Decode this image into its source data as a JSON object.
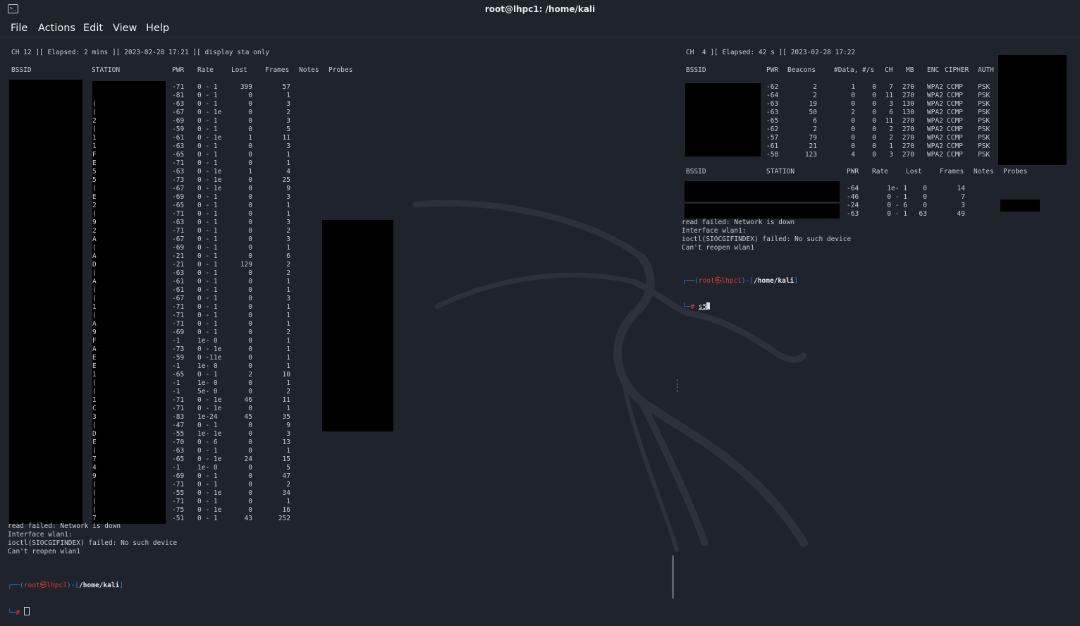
{
  "window": {
    "title": "root@lhpc1: /home/kali"
  },
  "menu": [
    "File",
    "Actions",
    "Edit",
    "View",
    "Help"
  ],
  "left": {
    "header": "CH 12 ][ Elapsed: 2 mins ][ 2023-02-28 17:21 ][ display sta only",
    "columns": [
      "BSSID",
      "STATION",
      "PWR",
      "Rate",
      "Lost",
      "Frames",
      "Notes",
      "Probes"
    ],
    "rows": [
      [
        "-71",
        "0 - 1",
        "399",
        "57"
      ],
      [
        "-81",
        "0 - 1",
        "0",
        "1"
      ],
      [
        "-63",
        "0 - 1",
        "0",
        "3"
      ],
      [
        "-67",
        "0 - 1e",
        "0",
        "2"
      ],
      [
        "-69",
        "0 - 1",
        "0",
        "3"
      ],
      [
        "-59",
        "0 - 1",
        "0",
        "5"
      ],
      [
        "-61",
        "0 - 1e",
        "1",
        "11"
      ],
      [
        "-63",
        "0 - 1",
        "0",
        "3"
      ],
      [
        "-65",
        "0 - 1",
        "0",
        "1"
      ],
      [
        "-71",
        "0 - 1",
        "0",
        "1"
      ],
      [
        "-63",
        "0 - 1e",
        "1",
        "4"
      ],
      [
        "-73",
        "0 - 1e",
        "0",
        "25"
      ],
      [
        "-67",
        "0 - 1e",
        "0",
        "9"
      ],
      [
        "-69",
        "0 - 1",
        "0",
        "3"
      ],
      [
        "-65",
        "0 - 1",
        "0",
        "1"
      ],
      [
        "-71",
        "0 - 1",
        "0",
        "1"
      ],
      [
        "-63",
        "0 - 1",
        "0",
        "3"
      ],
      [
        "-71",
        "0 - 1",
        "0",
        "2"
      ],
      [
        "-67",
        "0 - 1",
        "0",
        "3"
      ],
      [
        "-69",
        "0 - 1",
        "0",
        "1"
      ],
      [
        "-21",
        "0 - 1",
        "0",
        "6"
      ],
      [
        "-21",
        "0 - 1",
        "129",
        "2"
      ],
      [
        "-63",
        "0 - 1",
        "0",
        "2"
      ],
      [
        "-61",
        "0 - 1",
        "0",
        "1"
      ],
      [
        "-61",
        "0 - 1",
        "0",
        "1"
      ],
      [
        "-67",
        "0 - 1",
        "0",
        "3"
      ],
      [
        "-71",
        "0 - 1",
        "0",
        "1"
      ],
      [
        "-71",
        "0 - 1",
        "0",
        "1"
      ],
      [
        "-71",
        "0 - 1",
        "0",
        "1"
      ],
      [
        "-69",
        "0 - 1",
        "0",
        "2"
      ],
      [
        "-1",
        "1e- 0",
        "0",
        "1"
      ],
      [
        "-73",
        "0 - 1e",
        "0",
        "1"
      ],
      [
        "-59",
        "0 -11e",
        "0",
        "1"
      ],
      [
        "-1",
        "1e- 0",
        "0",
        "1"
      ],
      [
        "-65",
        "0 - 1",
        "2",
        "10"
      ],
      [
        "-1",
        "1e- 0",
        "0",
        "1"
      ],
      [
        "-1",
        "5e- 0",
        "0",
        "2"
      ],
      [
        "-71",
        "0 - 1e",
        "46",
        "11"
      ],
      [
        "-71",
        "0 - 1e",
        "0",
        "1"
      ],
      [
        "-83",
        "1e-24",
        "45",
        "35"
      ],
      [
        "-47",
        "0 - 1",
        "0",
        "9"
      ],
      [
        "-55",
        "1e- 1e",
        "0",
        "3"
      ],
      [
        "-70",
        "0 - 6",
        "0",
        "13"
      ],
      [
        "-63",
        "0 - 1",
        "0",
        "1"
      ],
      [
        "-65",
        "0 - 1e",
        "24",
        "15"
      ],
      [
        "-1",
        "1e- 0",
        "0",
        "5"
      ],
      [
        "-69",
        "0 - 1",
        "0",
        "47"
      ],
      [
        "-71",
        "0 - 1",
        "0",
        "2"
      ],
      [
        "-55",
        "0 - 1e",
        "0",
        "34"
      ],
      [
        "-71",
        "0 - 1",
        "0",
        "1"
      ],
      [
        "-75",
        "0 - 1e",
        "0",
        "16"
      ],
      [
        "-51",
        "0 - 1",
        "43",
        "252"
      ]
    ],
    "station_prefixes": [
      "",
      "",
      "(",
      "(",
      "2",
      "(",
      "1",
      "1",
      "F",
      "E",
      "5",
      "5",
      "(",
      "E",
      "2",
      "(",
      "9",
      "2",
      "A",
      "(",
      "A",
      "D",
      "(",
      "A",
      "(",
      "(",
      "1",
      "(",
      "A",
      "9",
      "F",
      "A",
      "E",
      "E",
      "1",
      "(",
      "(",
      "1",
      "C",
      "3",
      "(",
      "D",
      "E",
      "(",
      "7",
      "4",
      "9",
      "(",
      "(",
      "(",
      "(",
      "7"
    ],
    "messages": [
      "read failed: Network is down",
      "Interface wlan1:",
      "ioctl(SIOCGIFINDEX) failed: No such device",
      "Can't reopen wlan1"
    ],
    "prompt_user": "root",
    "prompt_host": "lhpc1",
    "prompt_path": "/home/kali"
  },
  "right": {
    "header": "CH  4 ][ Elapsed: 42 s ][ 2023-02-28 17:22",
    "ap_columns": [
      "BSSID",
      "PWR",
      "Beacons",
      "#Data, #/s",
      "CH",
      "MB",
      "ENC",
      "CIPHER",
      "AUTH"
    ],
    "ap_rows": [
      [
        "-62",
        "2",
        "1",
        "0",
        "7",
        "270",
        "WPA2",
        "CCMP",
        "PSK"
      ],
      [
        "-64",
        "2",
        "0",
        "0",
        "11",
        "270",
        "WPA2",
        "CCMP",
        "PSK"
      ],
      [
        "-63",
        "19",
        "0",
        "0",
        "3",
        "130",
        "WPA2",
        "CCMP",
        "PSK"
      ],
      [
        "-63",
        "50",
        "2",
        "0",
        "6",
        "130",
        "WPA2",
        "CCMP",
        "PSK"
      ],
      [
        "-65",
        "6",
        "0",
        "0",
        "11",
        "270",
        "WPA2",
        "CCMP",
        "PSK"
      ],
      [
        "-62",
        "2",
        "0",
        "0",
        "2",
        "270",
        "WPA2",
        "CCMP",
        "PSK"
      ],
      [
        "-57",
        "79",
        "0",
        "0",
        "2",
        "270",
        "WPA2",
        "CCMP",
        "PSK"
      ],
      [
        "-61",
        "21",
        "0",
        "0",
        "1",
        "270",
        "WPA2",
        "CCMP",
        "PSK"
      ],
      [
        "-58",
        "123",
        "4",
        "0",
        "3",
        "270",
        "WPA2",
        "CCMP",
        "PSK"
      ]
    ],
    "sta_columns": [
      "BSSID",
      "STATION",
      "PWR",
      "Rate",
      "Lost",
      "Frames",
      "Notes",
      "Probes"
    ],
    "sta_rows": [
      [
        "-64",
        "1e- 1",
        "0",
        "14"
      ],
      [
        "-46",
        "0 - 1",
        "0",
        "7"
      ],
      [
        "-24",
        "0 - 6",
        "0",
        "3"
      ],
      [
        "-63",
        "0 - 1",
        "63",
        "49"
      ]
    ],
    "messages": [
      "read failed: Network is down",
      "Interface wlan1:",
      "ioctl(SIOCGIFINDEX) failed: No such device",
      "Can't reopen wlan1"
    ],
    "prompt_user": "root",
    "prompt_host": "lhpc1",
    "prompt_path": "/home/kali",
    "typed": "s5"
  }
}
